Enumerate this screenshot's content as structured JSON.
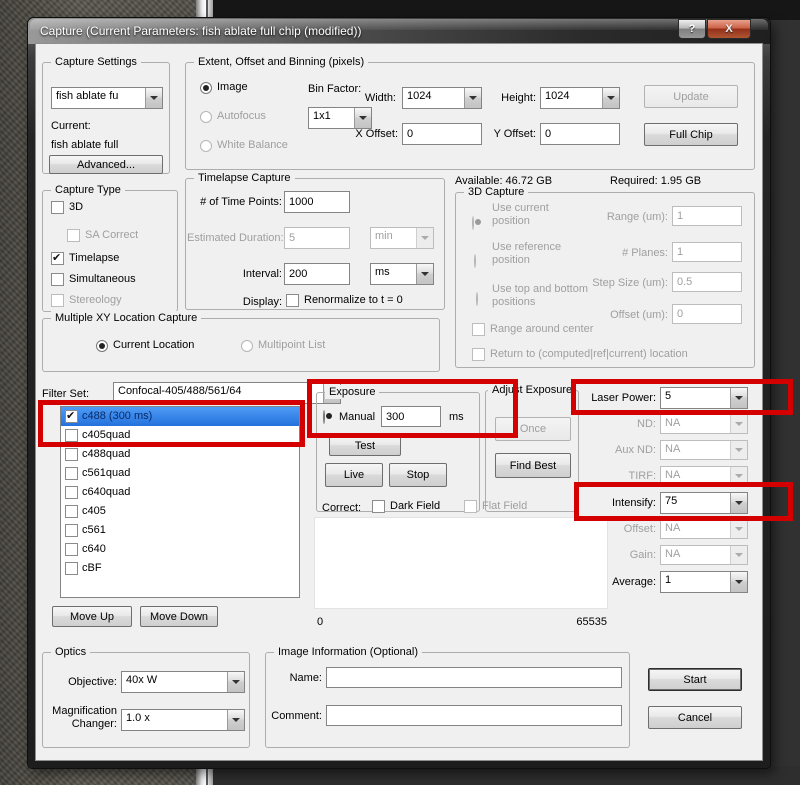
{
  "window": {
    "title": "Capture (Current Parameters: fish ablate full chip (modified))",
    "help_glyph": "?",
    "close_glyph": "X"
  },
  "capture_settings": {
    "legend": "Capture Settings",
    "preset_value": "fish ablate fu",
    "current_label": "Current:",
    "current_value": "fish ablate full",
    "advanced_label": "Advanced..."
  },
  "capture_type": {
    "legend": "Capture Type",
    "items": [
      {
        "label": "3D",
        "checked": false,
        "disabled": false
      },
      {
        "label": "SA Correct",
        "checked": false,
        "disabled": true
      },
      {
        "label": "Timelapse",
        "checked": true,
        "disabled": false
      },
      {
        "label": "Simultaneous",
        "checked": false,
        "disabled": false
      },
      {
        "label": "Stereology",
        "checked": false,
        "disabled": true
      }
    ]
  },
  "extent": {
    "legend": "Extent, Offset and Binning (pixels)",
    "image_label": "Image",
    "autofocus_label": "Autofocus",
    "white_balance_label": "White Balance",
    "bin_factor_label": "Bin Factor:",
    "bin_factor_value": "1x1",
    "width_label": "Width:",
    "width_value": "1024",
    "height_label": "Height:",
    "height_value": "1024",
    "x_offset_label": "X Offset:",
    "x_offset_value": "0",
    "y_offset_label": "Y Offset:",
    "y_offset_value": "0",
    "update_label": "Update",
    "full_chip_label": "Full Chip"
  },
  "timelapse": {
    "legend": "Timelapse Capture",
    "time_points_label": "# of Time Points:",
    "time_points_value": "1000",
    "estimated_duration_label": "Estimated Duration:",
    "estimated_duration_value": "5",
    "estimated_duration_unit": "min",
    "interval_label": "Interval:",
    "interval_value": "200",
    "interval_unit": "ms",
    "display_label": "Display:",
    "renormalize_label": "Renormalize to t = 0"
  },
  "storage": {
    "available": "Available: 46.72 GB",
    "required": "Required: 1.95 GB"
  },
  "capture_3d": {
    "legend": "3D Capture",
    "use_current_label": "Use current position",
    "use_reference_label": "Use reference position",
    "use_top_bottom_label": "Use top and bottom positions",
    "range_label": "Range (um):",
    "range_value": "1",
    "planes_label": "# Planes:",
    "planes_value": "1",
    "step_label": "Step Size (um):",
    "step_value": "0.5",
    "offset_label": "Offset (um):",
    "offset_value": "0",
    "range_around_label": "Range around center",
    "return_label": "Return to (computed|ref|current) location"
  },
  "xy": {
    "legend": "Multiple XY Location Capture",
    "current_label": "Current Location",
    "multipoint_label": "Multipoint List"
  },
  "filter": {
    "label": "Filter Set:",
    "value": "Confocal-405/488/561/64",
    "items": [
      {
        "label": "c488 (300 ms)",
        "checked": true,
        "selected": true
      },
      {
        "label": "c405quad",
        "checked": false,
        "selected": false
      },
      {
        "label": "c488quad",
        "checked": false,
        "selected": false
      },
      {
        "label": "c561quad",
        "checked": false,
        "selected": false
      },
      {
        "label": "c640quad",
        "checked": false,
        "selected": false
      },
      {
        "label": "c405",
        "checked": false,
        "selected": false
      },
      {
        "label": "c561",
        "checked": false,
        "selected": false
      },
      {
        "label": "c640",
        "checked": false,
        "selected": false
      },
      {
        "label": "cBF",
        "checked": false,
        "selected": false
      }
    ],
    "move_up_label": "Move Up",
    "move_down_label": "Move Down"
  },
  "exposure": {
    "legend": "Exposure",
    "manual_label": "Manual",
    "manual_value": "300",
    "unit": "ms",
    "test_label": "Test",
    "live_label": "Live",
    "stop_label": "Stop"
  },
  "adjust_exposure": {
    "legend": "Adjust Exposure",
    "once_label": "Once",
    "find_best_label": "Find Best"
  },
  "correct": {
    "label": "Correct:",
    "dark_field_label": "Dark Field",
    "flat_field_label": "Flat Field"
  },
  "histogram": {
    "min": "0",
    "max": "65535"
  },
  "camera": {
    "rows": [
      {
        "label": "Laser Power:",
        "value": "5",
        "disabled": false
      },
      {
        "label": "ND:",
        "value": "NA",
        "disabled": true
      },
      {
        "label": "Aux ND:",
        "value": "NA",
        "disabled": true
      },
      {
        "label": "TIRF:",
        "value": "NA",
        "disabled": true
      },
      {
        "label": "Intensify:",
        "value": "75",
        "disabled": false
      },
      {
        "label": "Offset:",
        "value": "NA",
        "disabled": true
      },
      {
        "label": "Gain:",
        "value": "NA",
        "disabled": true
      },
      {
        "label": "Average:",
        "value": "1",
        "disabled": false
      }
    ]
  },
  "optics": {
    "legend": "Optics",
    "objective_label": "Objective:",
    "objective_value": "40x W",
    "magnification_label": "Magnification Changer:",
    "magnification_value": "1.0 x"
  },
  "image_info": {
    "legend": "Image Information (Optional)",
    "name_label": "Name:",
    "name_value": "",
    "comment_label": "Comment:",
    "comment_value": ""
  },
  "actions": {
    "start_label": "Start",
    "cancel_label": "Cancel"
  },
  "colors": {
    "annotation": "#d40000",
    "selection": "#2e7fe0"
  }
}
